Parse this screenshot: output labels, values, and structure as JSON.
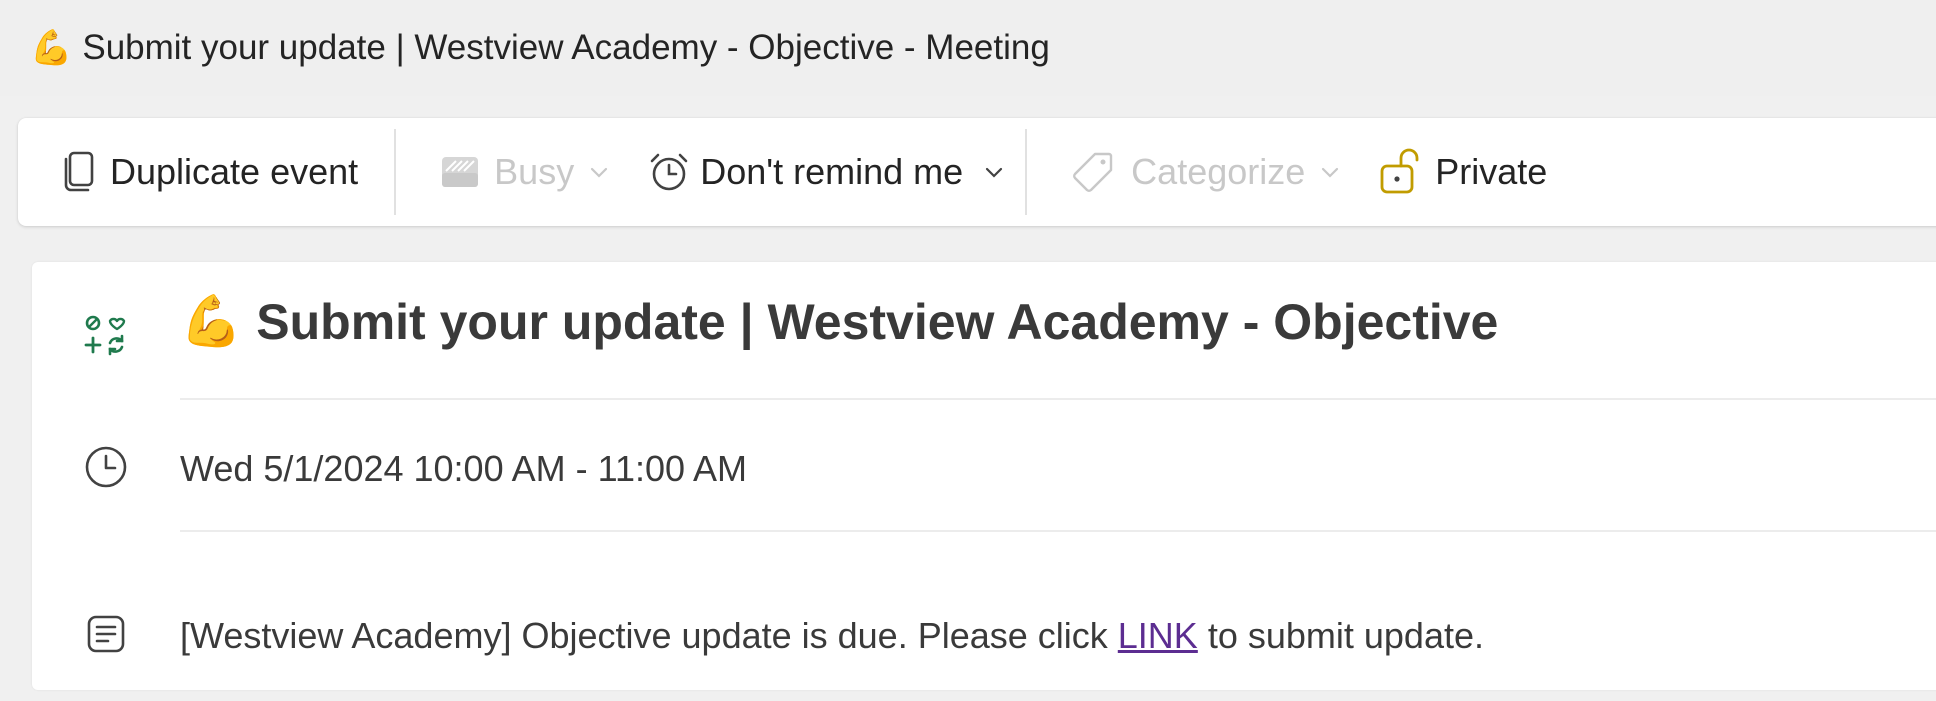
{
  "window": {
    "title_emoji": "💪",
    "title": "Submit your update | Westview Academy - Objective - Meeting"
  },
  "toolbar": {
    "duplicate_label": "Duplicate event",
    "busy_label": "Busy",
    "reminder_label": "Don't remind me",
    "categorize_label": "Categorize",
    "private_label": "Private"
  },
  "event": {
    "title_emoji": "💪",
    "title": "Submit your update | Westview Academy - Objective",
    "time": "Wed 5/1/2024 10:00 AM - 11:00 AM",
    "description_before": "[Westview Academy] Objective update is due. Please click ",
    "description_link": "LINK",
    "description_after": " to submit update."
  },
  "colors": {
    "app_icon_green": "#1f7a4d",
    "private_icon_gold": "#c19c00",
    "link_purple": "#5c2d91",
    "disabled_text": "#c8c8c8"
  },
  "icons": {
    "duplicate": "copy-icon",
    "busy": "busy-status-icon",
    "reminder": "alarm-clock-icon",
    "categorize": "tag-icon",
    "private": "lock-open-icon",
    "app": "app-grid-icon",
    "time": "clock-icon",
    "description": "notes-icon"
  }
}
